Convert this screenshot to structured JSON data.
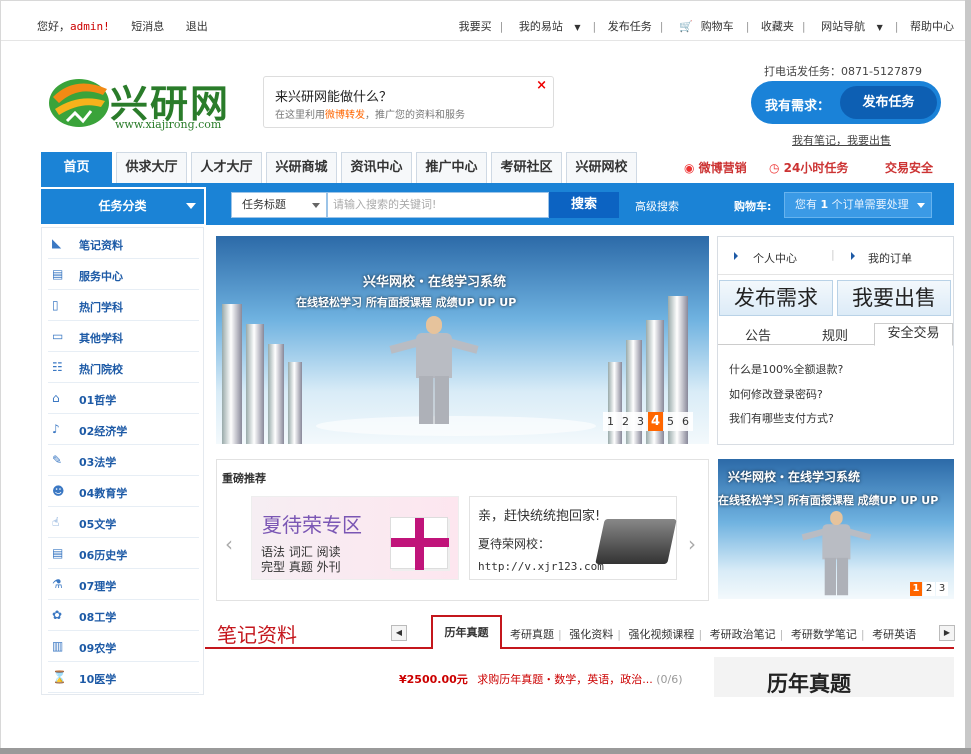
{
  "topbar": {
    "greeting": "您好，",
    "username": "admin!",
    "messages": "短消息",
    "logout": "退出",
    "links": [
      "我要买",
      "我的易站",
      "发布任务",
      "购物车",
      "收藏夹",
      "网站导航",
      "帮助中心"
    ]
  },
  "logo": {
    "text": "兴研网",
    "url": "www.xiajirong.com"
  },
  "promo": {
    "title": "来兴研网能做什么？",
    "sub_pre": "在这里利用",
    "sub_em": "微博转发",
    "sub_post": "，推广您的资料和服务",
    "close": "×"
  },
  "contact": {
    "phone": "打电话发任务：0871-5127879"
  },
  "need": {
    "label": "我有需求：",
    "button": "发布任务",
    "notes": "我有笔记，我要出售"
  },
  "nav": {
    "tabs": [
      "首页",
      "供求大厅",
      "人才大厅",
      "兴研商城",
      "资讯中心",
      "推广中心",
      "考研社区",
      "兴研网校"
    ],
    "extras": [
      "微博营销",
      "24小时任务",
      "交易安全"
    ]
  },
  "category": {
    "title": "任务分类",
    "items": [
      {
        "icon": "book-icon",
        "label": "笔记资料"
      },
      {
        "icon": "window-icon",
        "label": "服务中心"
      },
      {
        "icon": "doc-icon",
        "label": "热门学科"
      },
      {
        "icon": "monitor-icon",
        "label": "其他学科"
      },
      {
        "icon": "school-icon",
        "label": "热门院校"
      },
      {
        "icon": "house-icon",
        "label": "01哲学"
      },
      {
        "icon": "music-icon",
        "label": "02经济学"
      },
      {
        "icon": "pen-icon",
        "label": "03法学"
      },
      {
        "icon": "person-icon",
        "label": "04教育学"
      },
      {
        "icon": "thumb-icon",
        "label": "05文学"
      },
      {
        "icon": "scroll-icon",
        "label": "06历史学"
      },
      {
        "icon": "flask-icon",
        "label": "07理学"
      },
      {
        "icon": "gear-icon",
        "label": "08工学"
      },
      {
        "icon": "leaf-icon",
        "label": "09农学"
      },
      {
        "icon": "cross-icon",
        "label": "10医学"
      }
    ]
  },
  "search": {
    "select": "任务标题",
    "placeholder": "请输入搜索的关键词!",
    "button": "搜索",
    "advanced": "高级搜索",
    "cart_label": "购物车:",
    "cart_pre": "您有",
    "cart_count": "1",
    "cart_post": "个订单需要处理"
  },
  "banner": {
    "title": "兴华网校・在线学习系统",
    "subtitle": "在线轻松学习 所有面授课程 成绩UP UP UP",
    "pages": [
      "1",
      "2",
      "3",
      "4",
      "5",
      "6"
    ],
    "active_page": "4"
  },
  "user_panel": {
    "center": "个人中心",
    "orders": "我的订单",
    "publish": "发布需求",
    "sell": "我要出售",
    "tabs": [
      "公告",
      "规则",
      "安全交易"
    ],
    "faqs": [
      "什么是100%全额退款?",
      "如何修改登录密码?",
      "我们有哪些支付方式?"
    ]
  },
  "recommend": {
    "title": "重磅推荐",
    "ad1": {
      "title": "夏待荣专区",
      "lines": [
        "语法 词汇 阅读",
        "完型 真题 外刊"
      ]
    },
    "ad2": {
      "line1": "亲，赶快统统抱回家!",
      "line2": "夏待荣网校：",
      "url": "http://v.xjr123.com"
    }
  },
  "banner_small": {
    "title": "兴华网校・在线学习系统",
    "subtitle": "在线轻松学习 所有面授课程 成绩UP UP UP",
    "pages": [
      "1",
      "2",
      "3"
    ]
  },
  "notes_section": {
    "title": "笔记资料",
    "active_tab": "历年真题",
    "tabs": [
      "考研真题",
      "强化资料",
      "强化视频课程",
      "考研政治笔记",
      "考研数学笔记",
      "考研英语"
    ],
    "item_price": "¥2500.00元",
    "item_title": "求购历年真题・数学，英语，政治...",
    "item_count": "(0/6)",
    "right_title": "历年真题"
  },
  "colors": {
    "primary": "#1b83d6",
    "accent_red": "#c4161c",
    "orange": "#ff6600"
  }
}
